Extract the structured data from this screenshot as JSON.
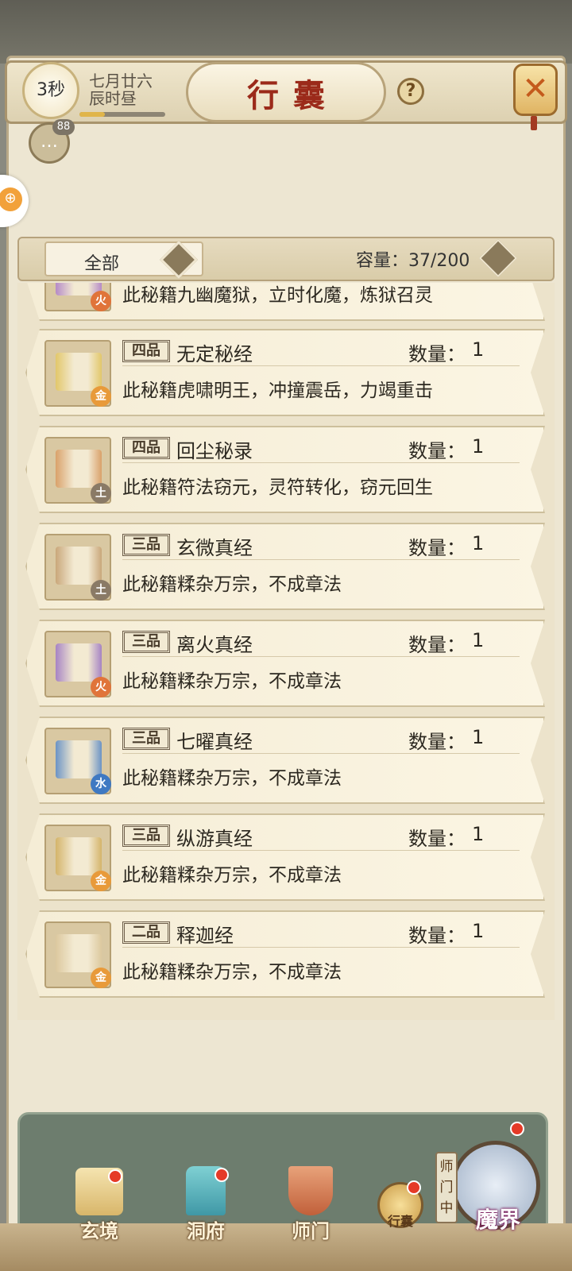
{
  "header": {
    "title": "行囊",
    "help_symbol": "?",
    "close_symbol": "✕",
    "timer": "3秒",
    "date_line1": "七月廿六",
    "date_line2": "辰时昼",
    "time_progress": 0.3,
    "chat_badge": "88",
    "chat_symbol": "…"
  },
  "side_button_symbol": "⊕",
  "filter": {
    "selected": "全部",
    "capacity": "容量：37/200"
  },
  "items": [
    {
      "grade": "",
      "name": "",
      "qty_label": "",
      "qty": "",
      "desc": "此秘籍九幽魔狱，立时化魔，炼狱召灵",
      "element": "火",
      "element_color": "#e0743a",
      "scroll_color": "#b58ac7"
    },
    {
      "grade": "四品",
      "name": "无定秘经",
      "qty_label": "数量：",
      "qty": "1",
      "desc": "此秘籍虎啸明王，冲撞震岳，力竭重击",
      "element": "金",
      "element_color": "#e89a3a",
      "scroll_color": "#e2c76a"
    },
    {
      "grade": "四品",
      "name": "回尘秘录",
      "qty_label": "数量：",
      "qty": "1",
      "desc": "此秘籍符法窃元，灵符转化，窃元回生",
      "element": "土",
      "element_color": "#8a7a66",
      "scroll_color": "#d9a16a"
    },
    {
      "grade": "三品",
      "name": "玄微真经",
      "qty_label": "数量：",
      "qty": "1",
      "desc": "此秘籍糅杂万宗，不成章法",
      "element": "土",
      "element_color": "#8a7a66",
      "scroll_color": "#c9a77a"
    },
    {
      "grade": "三品",
      "name": "离火真经",
      "qty_label": "数量：",
      "qty": "1",
      "desc": "此秘籍糅杂万宗，不成章法",
      "element": "火",
      "element_color": "#e0743a",
      "scroll_color": "#a683c4"
    },
    {
      "grade": "三品",
      "name": "七曜真经",
      "qty_label": "数量：",
      "qty": "1",
      "desc": "此秘籍糅杂万宗，不成章法",
      "element": "水",
      "element_color": "#3f79c2",
      "scroll_color": "#6b93c5"
    },
    {
      "grade": "三品",
      "name": "纵游真经",
      "qty_label": "数量：",
      "qty": "1",
      "desc": "此秘籍糅杂万宗，不成章法",
      "element": "金",
      "element_color": "#e89a3a",
      "scroll_color": "#d4b46a"
    },
    {
      "grade": "二品",
      "name": "释迦经",
      "qty_label": "数量：",
      "qty": "1",
      "desc": "此秘籍糅杂万宗，不成章法",
      "element": "金",
      "element_color": "#e89a3a",
      "scroll_color": "#dcc89e"
    }
  ],
  "nav": {
    "xuanjing": "玄境",
    "dongfu": "洞府",
    "shimen": "师门",
    "xingnang": "行囊",
    "mojie": "魔界",
    "shimen_tag": "师门中"
  }
}
